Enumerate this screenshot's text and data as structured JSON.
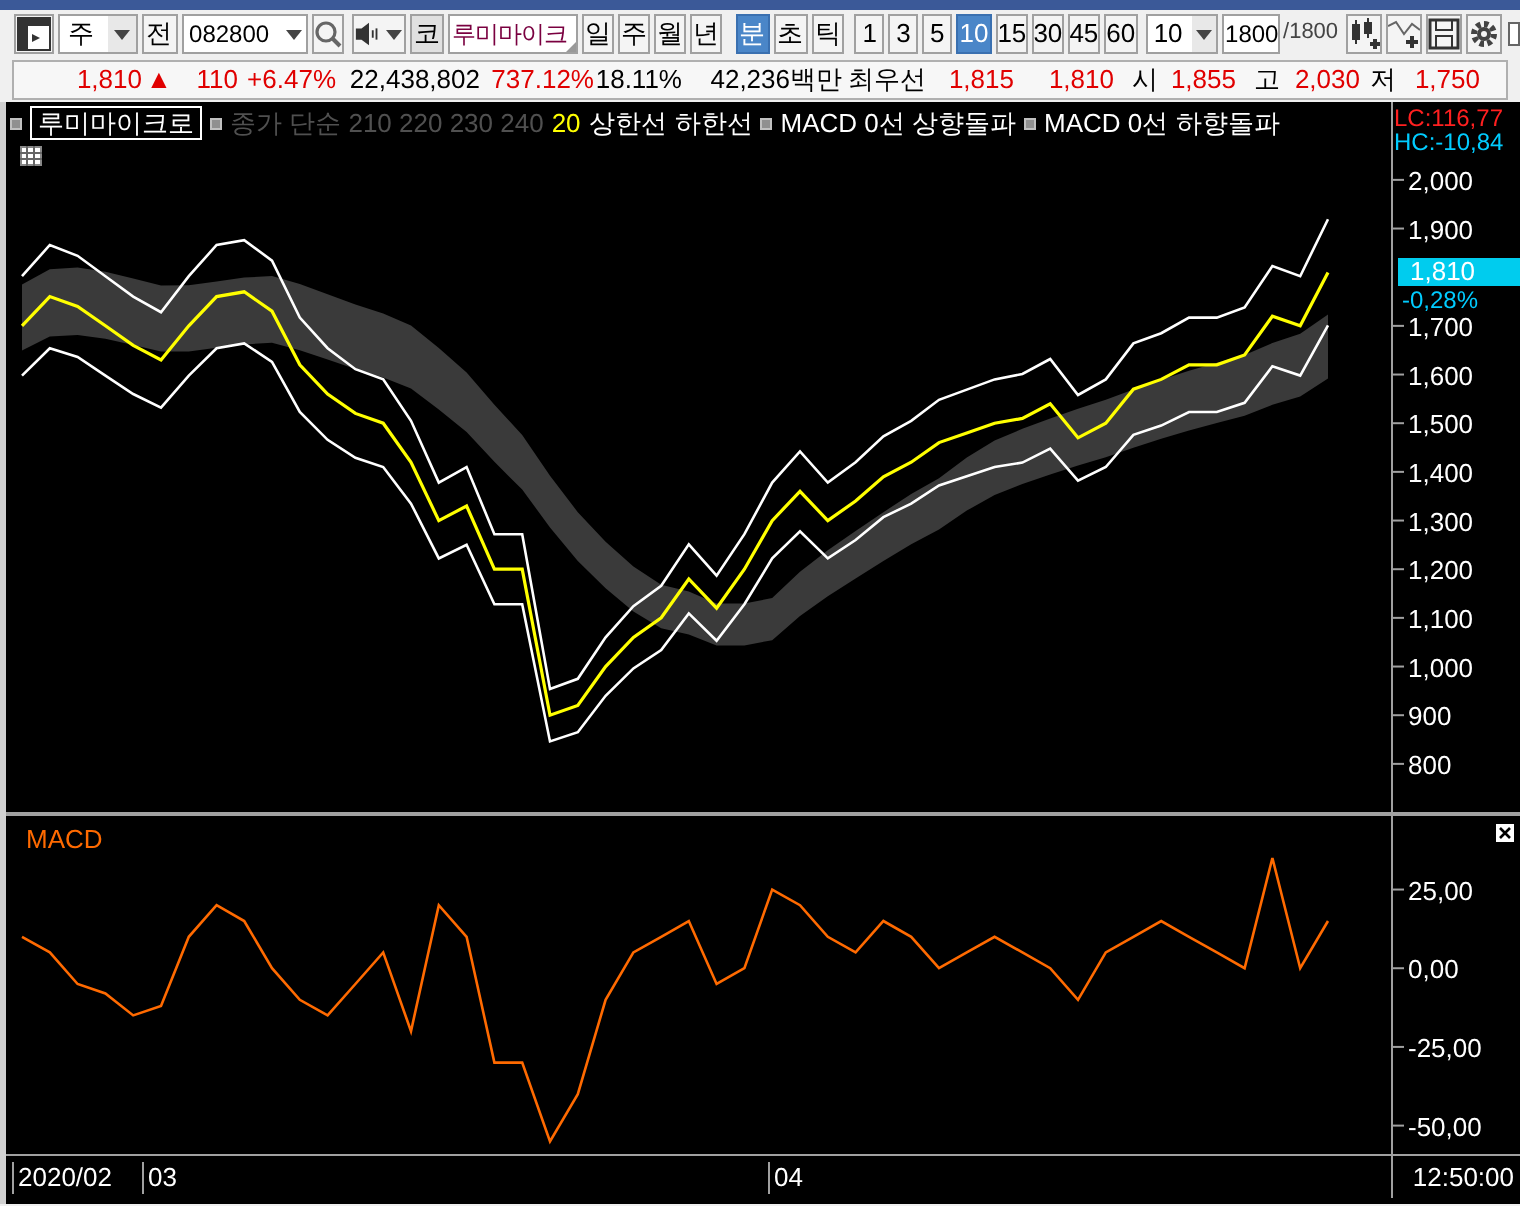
{
  "toolbar": {
    "period_select": "주",
    "prev_label": "전",
    "code": "082800",
    "market_label": "코",
    "stock_name": "루미마이크",
    "periods": [
      {
        "label": "일",
        "selected": false
      },
      {
        "label": "주",
        "selected": false
      },
      {
        "label": "월",
        "selected": false
      },
      {
        "label": "년",
        "selected": false
      },
      {
        "label": "분",
        "selected": true
      },
      {
        "label": "초",
        "selected": false
      },
      {
        "label": "틱",
        "selected": false
      }
    ],
    "intervals": [
      {
        "label": "1",
        "selected": false
      },
      {
        "label": "3",
        "selected": false
      },
      {
        "label": "5",
        "selected": false
      },
      {
        "label": "10",
        "selected": true
      },
      {
        "label": "15",
        "selected": false
      },
      {
        "label": "30",
        "selected": false
      },
      {
        "label": "45",
        "selected": false
      },
      {
        "label": "60",
        "selected": false
      }
    ],
    "interval_count": "10",
    "bar_count": "1800",
    "bar_total": "/1800",
    "checked": false
  },
  "price": {
    "text": "1,810",
    "arrow": "▲",
    "color": "#e00000"
  },
  "quote": [
    {
      "text": "110",
      "color": "#e00000"
    },
    {
      "text": "+6.47%",
      "color": "#e00000"
    },
    {
      "text": "22,438,802",
      "color": "#000000"
    },
    {
      "text": "737.12%",
      "color": "#e00000"
    },
    {
      "text": "18.11%",
      "color": "#000000"
    },
    {
      "text": "42,236백만",
      "color": "#000000"
    },
    {
      "text": "최우선",
      "color": "#000000"
    },
    {
      "text": "1,815",
      "color": "#e00000"
    },
    {
      "text": "1,810",
      "color": "#e00000"
    },
    {
      "text": "시",
      "color": "#000000"
    },
    {
      "text": "1,855",
      "color": "#e00000"
    },
    {
      "text": "고",
      "color": "#000000"
    },
    {
      "text": "2,030",
      "color": "#e00000"
    },
    {
      "text": "저",
      "color": "#000000"
    },
    {
      "text": "1,750",
      "color": "#e00000"
    }
  ],
  "legend": [
    {
      "text": "루미마이크로",
      "marker": true,
      "boxed": true,
      "color": "#ffffff"
    },
    {
      "text": "종가 단순 210  220  230  240",
      "marker": true,
      "boxed": false,
      "color": "#505050"
    },
    {
      "text": "20",
      "marker": false,
      "boxed": false,
      "color": "#ffff00"
    },
    {
      "text": "상한선",
      "marker": false,
      "boxed": false,
      "color": "#ffffff"
    },
    {
      "text": "하한선",
      "marker": false,
      "boxed": false,
      "color": "#ffffff"
    },
    {
      "text": "MACD 0선 상향돌파",
      "marker": true,
      "boxed": false,
      "color": "#ffffff"
    },
    {
      "text": "MACD 0선 하향돌파",
      "marker": true,
      "boxed": false,
      "color": "#ffffff"
    }
  ],
  "price_panel": {
    "lc": "LC:116,77",
    "hc": "HC:-10,84",
    "marker_price": "1,810",
    "marker_change": "-0,28%",
    "chart_data": {
      "type": "line",
      "series": [
        {
          "color": "#ffffff",
          "values": [
            1802,
            1866,
            1844,
            1802,
            1760,
            1728,
            1802,
            1866,
            1876,
            1834,
            1717,
            1654,
            1611,
            1590,
            1505,
            1378,
            1410,
            1272,
            1272,
            954,
            975,
            1060,
            1124,
            1166,
            1251,
            1187,
            1272,
            1378,
            1442,
            1378,
            1420,
            1473,
            1505,
            1548,
            1569,
            1590,
            1601,
            1632,
            1558,
            1590,
            1664,
            1685,
            1717,
            1717,
            1738,
            1823,
            1802,
            1919
          ]
        },
        {
          "color": "#ffffff",
          "values": [
            1598,
            1654,
            1636,
            1598,
            1560,
            1532,
            1598,
            1654,
            1664,
            1626,
            1523,
            1466,
            1429,
            1410,
            1335,
            1222,
            1250,
            1128,
            1128,
            846,
            865,
            940,
            996,
            1034,
            1109,
            1053,
            1128,
            1222,
            1278,
            1222,
            1260,
            1307,
            1335,
            1372,
            1391,
            1410,
            1419,
            1448,
            1382,
            1410,
            1476,
            1495,
            1523,
            1523,
            1542,
            1617,
            1598,
            1701
          ]
        },
        {
          "color": "#ffff00",
          "values": [
            1700,
            1760,
            1740,
            1700,
            1660,
            1630,
            1700,
            1760,
            1770,
            1730,
            1620,
            1560,
            1520,
            1500,
            1420,
            1300,
            1330,
            1200,
            1200,
            900,
            920,
            1000,
            1060,
            1100,
            1180,
            1120,
            1200,
            1300,
            1360,
            1300,
            1340,
            1390,
            1420,
            1460,
            1480,
            1500,
            1510,
            1540,
            1470,
            1500,
            1570,
            1590,
            1620,
            1620,
            1640,
            1720,
            1700,
            1810
          ]
        }
      ],
      "ylim": [
        697,
        2160
      ],
      "yticks": [
        {
          "value": 800,
          "label": "800"
        },
        {
          "value": 900,
          "label": "900"
        },
        {
          "value": 1000,
          "label": "1,000"
        },
        {
          "value": 1100,
          "label": "1,100"
        },
        {
          "value": 1200,
          "label": "1,200"
        },
        {
          "value": 1300,
          "label": "1,300"
        },
        {
          "value": 1400,
          "label": "1,400"
        },
        {
          "value": 1500,
          "label": "1,500"
        },
        {
          "value": 1600,
          "label": "1,600"
        },
        {
          "value": 1700,
          "label": "1,700"
        },
        {
          "value": 1900,
          "label": "1,900"
        },
        {
          "value": 2000,
          "label": "2,000"
        }
      ]
    }
  },
  "macd_panel": {
    "title": "MACD",
    "chart_data": {
      "type": "line",
      "series": [
        {
          "color": "#ff6a00",
          "values": [
            10,
            5,
            -5,
            -8,
            -15,
            -12,
            10,
            20,
            15,
            0,
            -10,
            -15,
            -5,
            5,
            -20,
            20,
            10,
            -30,
            -30,
            -55,
            -40,
            -10,
            5,
            10,
            15,
            -5,
            0,
            25,
            20,
            10,
            5,
            15,
            10,
            0,
            5,
            10,
            5,
            0,
            -10,
            5,
            10,
            15,
            10,
            5,
            0,
            35,
            0,
            15
          ]
        }
      ],
      "ylim": [
        -73,
        49
      ],
      "yticks": [
        {
          "value": 25,
          "label": "25,00"
        },
        {
          "value": 0,
          "label": "0,00"
        },
        {
          "value": -25,
          "label": "-25,00"
        },
        {
          "value": -50,
          "label": "-50,00"
        }
      ]
    }
  },
  "date_labels": [
    "2020/02",
    "03",
    "04"
  ],
  "time": "12:50:00"
}
